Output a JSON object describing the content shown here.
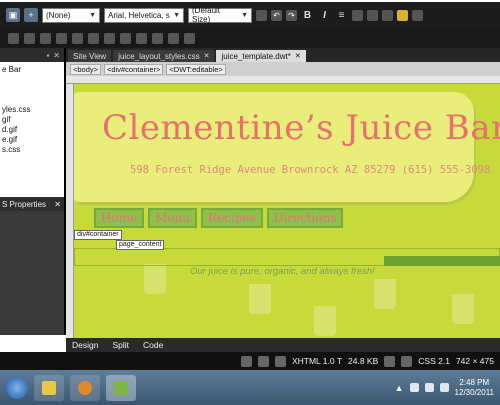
{
  "toolbar": {
    "style_select": "(None)",
    "font_select": "Arial, Helvetica, sans-serif",
    "size_select": "(Default Size)",
    "format_buttons": [
      "B",
      "I",
      "≡"
    ]
  },
  "left_panel": {
    "files": [
      "e Bar",
      "",
      "",
      "",
      "yles.css",
      "gif",
      "d.gif",
      "e.gif",
      "s.css"
    ],
    "properties_title": "S Properties"
  },
  "tabs": [
    {
      "label": "Site View",
      "active": false
    },
    {
      "label": "juice_layout_styles.css",
      "active": false
    },
    {
      "label": "juice_template.dwt*",
      "active": true
    }
  ],
  "tag_selector": [
    "<body>",
    "<div#container>",
    "<DWT:editable>"
  ],
  "page": {
    "title": "Clementine’s Juice Bar",
    "address": "598 Forest Ridge Avenue Brownrock AZ 85279 (615) 555-3098",
    "nav": [
      "Home",
      "Menu",
      "Recipes",
      "Directions"
    ],
    "div_label": "div#container",
    "content_label": "page_content",
    "tagline": "Our juice is pure, organic, and always fresh!"
  },
  "view_modes": [
    "Design",
    "Split",
    "Code"
  ],
  "status": {
    "doctype": "XHTML 1.0 T",
    "size": "24.8 KB",
    "css": "CSS 2.1",
    "dimensions": "742 × 475"
  },
  "clock": {
    "time": "2:48 PM",
    "date": "12/30/2011"
  }
}
